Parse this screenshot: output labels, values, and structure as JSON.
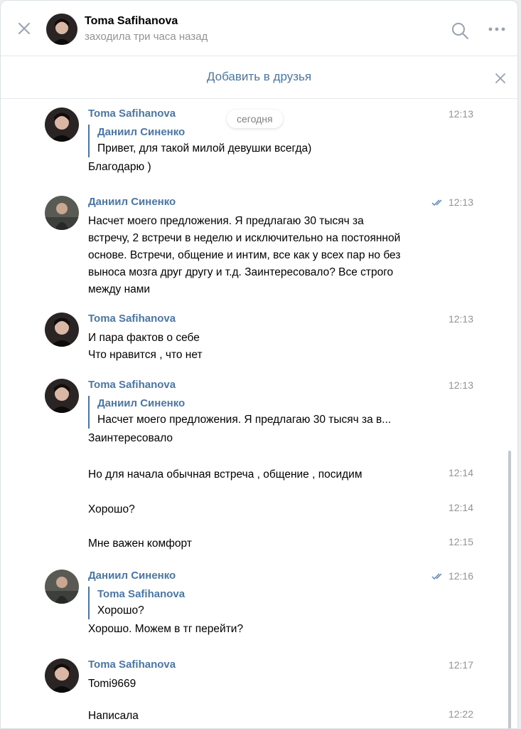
{
  "header": {
    "contact_name": "Toma Safihanova",
    "contact_status": "заходила три часа назад"
  },
  "friend_bar": {
    "add_label": "Добавить в друзья"
  },
  "date_divider": "сегодня",
  "messages": [
    {
      "author": "Toma Safihanova",
      "time": "12:13",
      "quote_author": "Даниил Синенко",
      "quote_text": "Привет, для такой милой девушки всегда)",
      "text": "Благодарю )"
    },
    {
      "author": "Даниил Синенко",
      "time": "12:13",
      "read": true,
      "text": "Насчет моего предложения. Я предлагаю 30 тысяч за встречу, 2 встречи в неделю и исключительно на постоянной основе. Встречи, общение и интим, все как у всех пар но без выноса мозга друг другу и т.д. Заинтересовало? Все строго между нами"
    },
    {
      "author": "Toma Safihanova",
      "time": "12:13",
      "lines": [
        "И пара фактов о себе",
        "Что нравится , что нет"
      ]
    },
    {
      "author": "Toma Safihanova",
      "time": "12:13",
      "quote_author": "Даниил Синенко",
      "quote_text": "Насчет моего предложения. Я предлагаю 30 тысяч за в...",
      "text": "Заинтересовало"
    },
    {
      "text": "Но для начала обычная встреча , общение , посидим",
      "time": "12:14"
    },
    {
      "text": "Хорошо?",
      "time": "12:14"
    },
    {
      "text": "Мне важен комфорт",
      "time": "12:15"
    },
    {
      "author": "Даниил Синенко",
      "time": "12:16",
      "read": true,
      "quote_author": "Toma Safihanova",
      "quote_text": "Хорошо?",
      "text": "Хорошо. Можем в тг перейти?"
    },
    {
      "author": "Toma Safihanova",
      "time": "12:17",
      "text": "Tomi9669"
    },
    {
      "text": "Написала",
      "time": "12:22"
    }
  ],
  "colors": {
    "link": "#4a76a8",
    "muted": "#939393",
    "divider": "#e7e8ec"
  },
  "icons": [
    "close-icon",
    "search-icon",
    "more-icon",
    "read-ticks-icon"
  ]
}
